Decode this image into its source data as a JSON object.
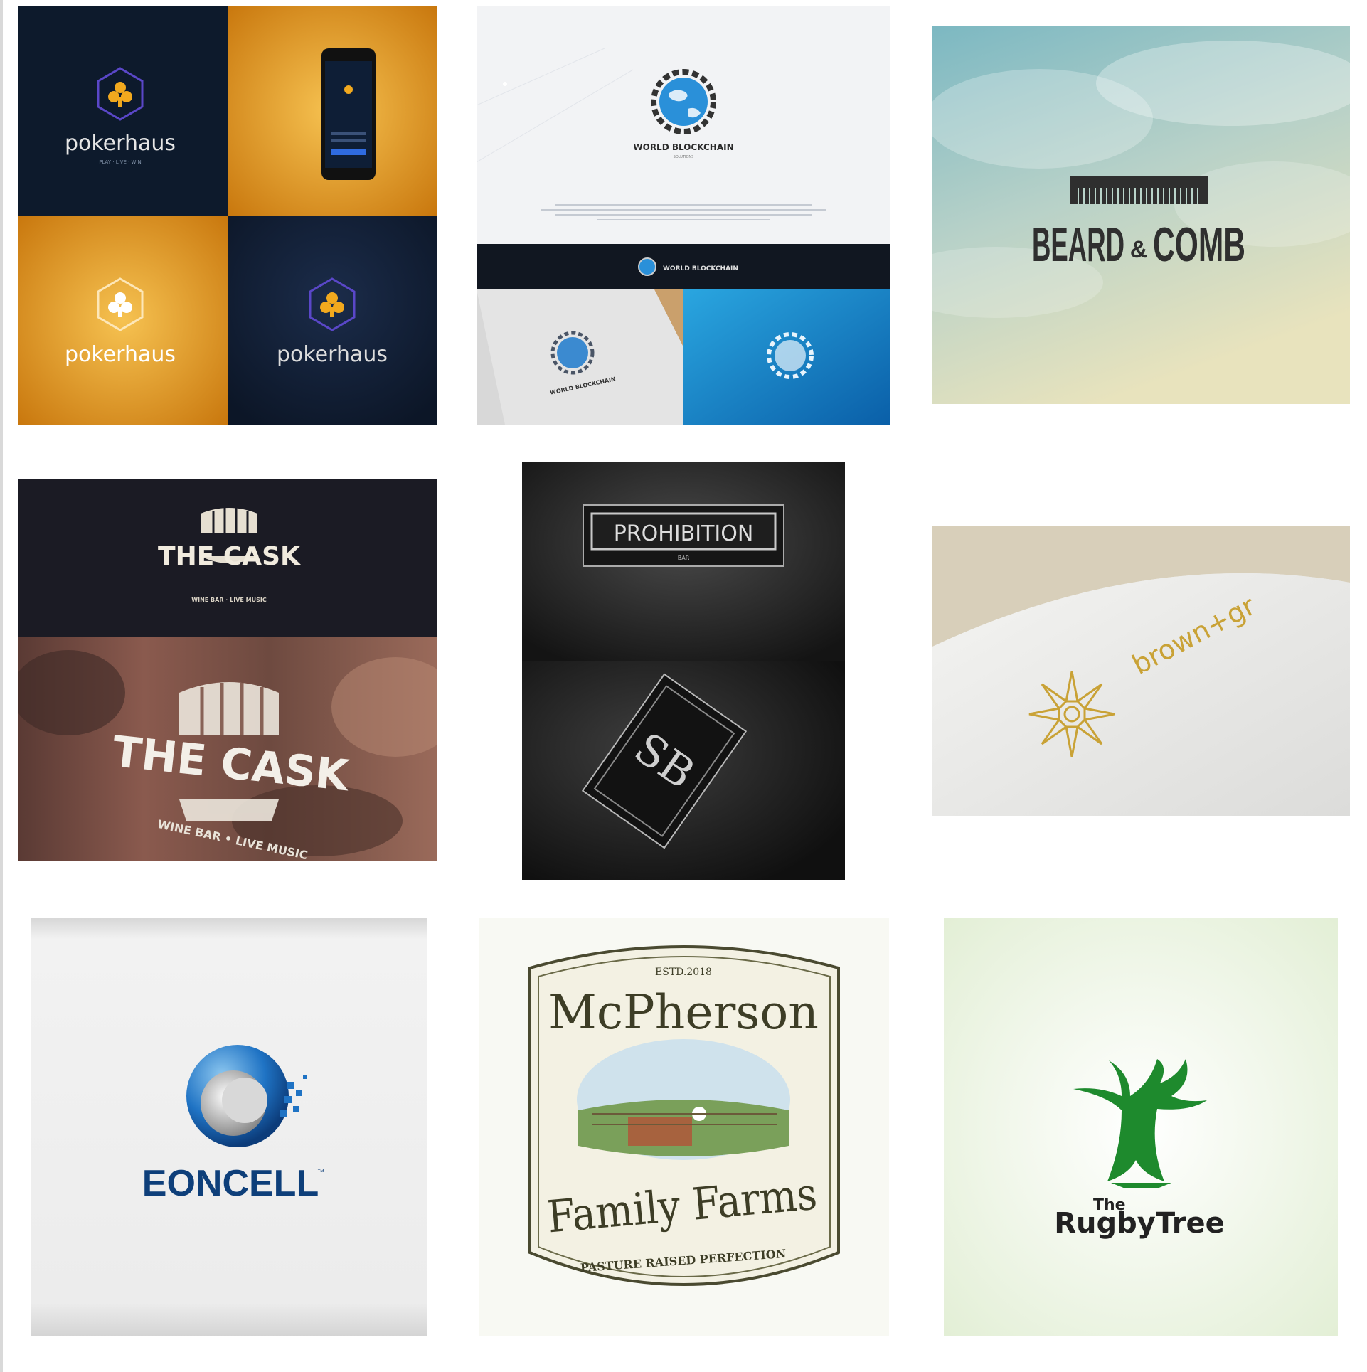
{
  "gallery": {
    "tiles": [
      {
        "id": "pokerhaus",
        "brand": "pokerhaus",
        "tagline": "PLAY · LIVE · WIN",
        "app_title": "pokerhaus"
      },
      {
        "id": "blockchain",
        "brand": "WORLD BLOCKCHAIN",
        "subbrand": "SOLUTIONS",
        "banner_brand": "WORLD BLOCKCHAIN"
      },
      {
        "id": "beard",
        "brand": "BEARD",
        "amp": "&",
        "brand2": "COMB"
      },
      {
        "id": "cask",
        "brand": "THE CASK",
        "tagline": "WINE BAR · LIVE MUSIC",
        "tagline_large": "WINE BAR • LIVE MUSIC"
      },
      {
        "id": "prohibition",
        "brand": "PROHIBITION",
        "tagline": "BAR",
        "monogram": "SB"
      },
      {
        "id": "brown",
        "brand": "brown+gr"
      },
      {
        "id": "eoncell",
        "brand": "EONCELL",
        "tm": "™"
      },
      {
        "id": "mcpherson",
        "estd": "ESTD.2018",
        "brand": "McPherson",
        "line2": "Family Farms",
        "tagline": "PASTURE RAISED PERFECTION"
      },
      {
        "id": "rugby",
        "the": "The",
        "brand": "RugbyTree"
      }
    ]
  },
  "colors": {
    "navy": "#0d1a2c",
    "gold": "#e8a21e",
    "blockchain_blue": "#1fa3dc",
    "cask_dark": "#1b1b24",
    "eoncell_blue": "#0e3f7a",
    "rugby_green": "#1e8a2d",
    "mcpherson_ink": "#3d3d26"
  }
}
